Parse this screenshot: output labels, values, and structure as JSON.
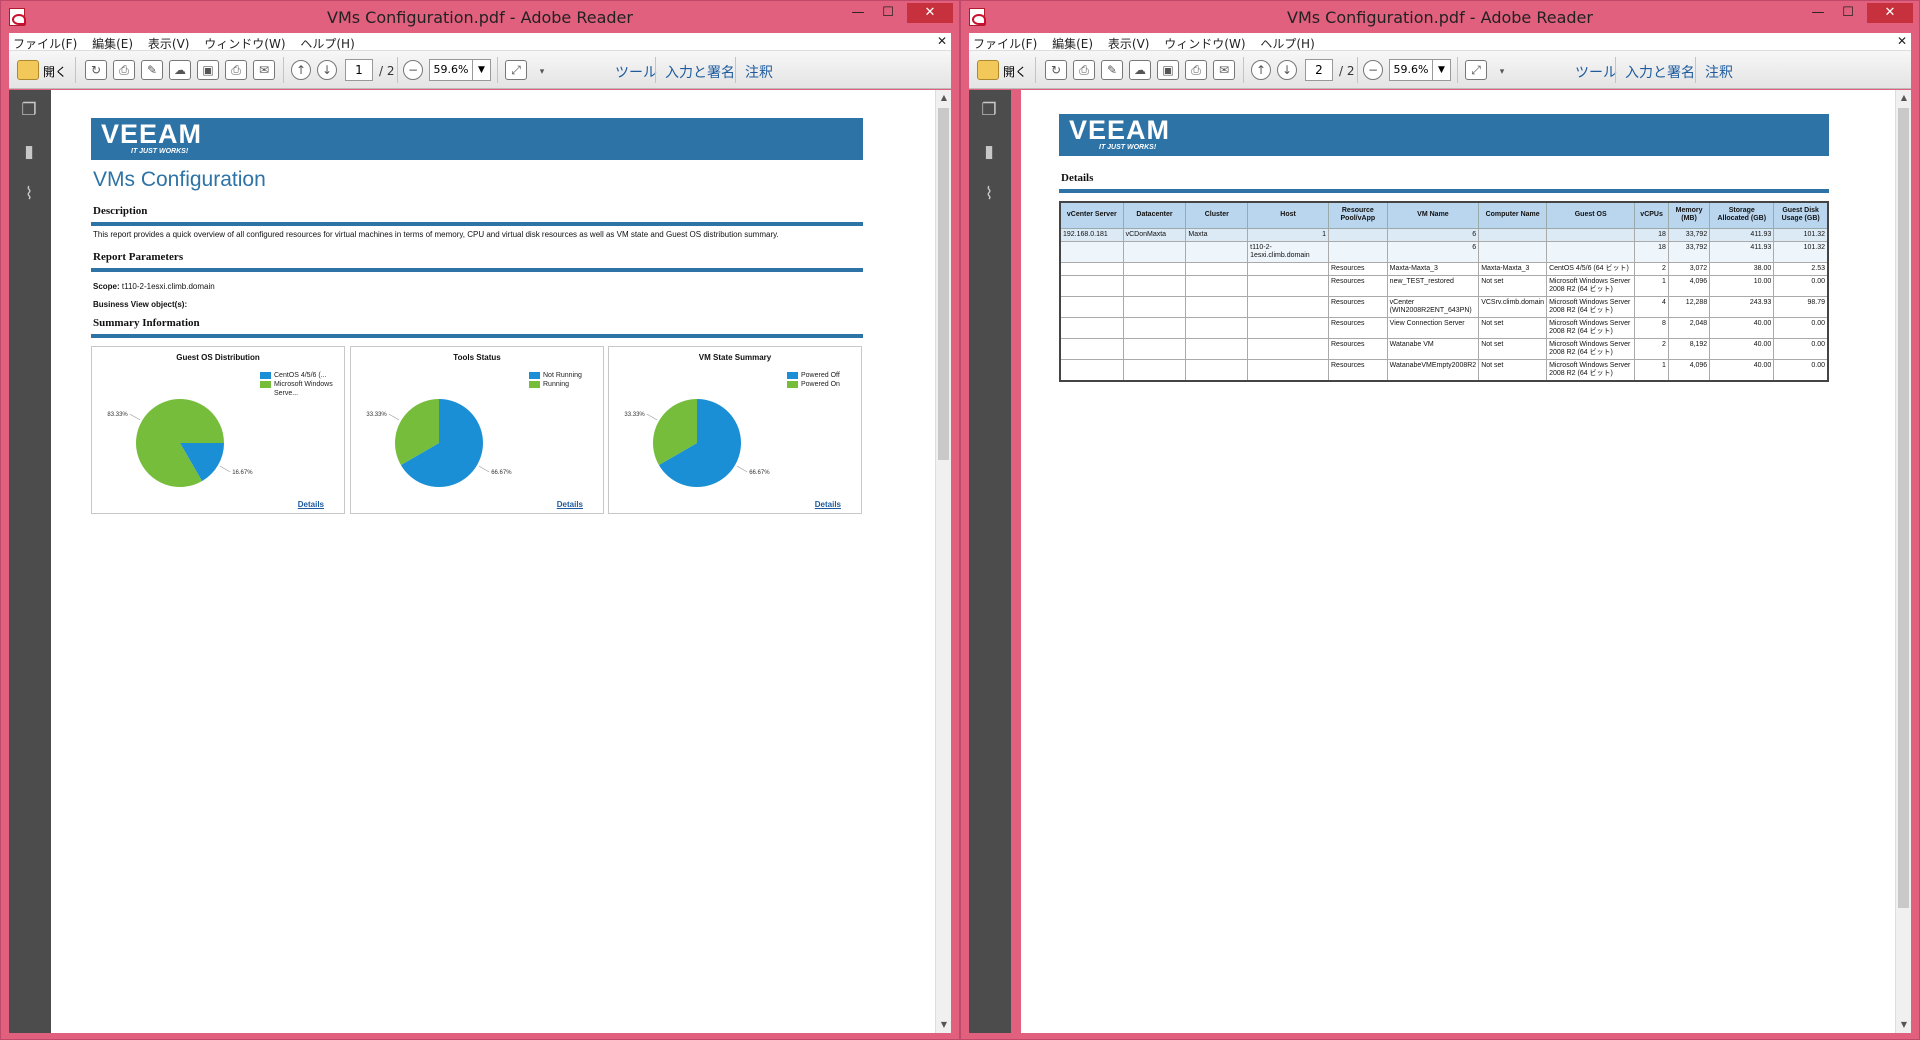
{
  "windows": [
    {
      "title": "VMs Configuration.pdf - Adobe Reader",
      "menu": [
        "ファイル(F)",
        "編集(E)",
        "表示(V)",
        "ウィンドウ(W)",
        "ヘルプ(H)"
      ],
      "toolbar": {
        "open_label": "開く",
        "page_current": "1",
        "page_total": "/ 2",
        "zoom": "59.6%",
        "tools": "ツール",
        "sign": "入力と署名",
        "comment": "注釈"
      },
      "report": {
        "title": "VMs Configuration",
        "description_head": "Description",
        "description": "This report provides a quick overview of all configured resources for virtual machines in terms of memory, CPU and virtual disk resources as well as VM state and Guest OS distribution summary.",
        "params_head": "Report Parameters",
        "scope_label": "Scope:",
        "scope_value": "t110-2-1esxi.climb.domain",
        "bv_label": "Business View object(s):",
        "summary_head": "Summary Information"
      }
    },
    {
      "title": "VMs Configuration.pdf - Adobe Reader",
      "menu": [
        "ファイル(F)",
        "編集(E)",
        "表示(V)",
        "ウィンドウ(W)",
        "ヘルプ(H)"
      ],
      "toolbar": {
        "open_label": "開く",
        "page_current": "2",
        "page_total": "/ 2",
        "zoom": "59.6%",
        "tools": "ツール",
        "sign": "入力と署名",
        "comment": "注釈"
      },
      "details_head": "Details"
    }
  ],
  "logo": {
    "word": "VEEAM",
    "tagline": "IT JUST WORKS!"
  },
  "colors": {
    "blue": "#1a8fd6",
    "green": "#76bd3c",
    "banner": "#2e73a6"
  },
  "chart_data": [
    {
      "type": "pie",
      "title": "Guest OS Distribution",
      "categories": [
        "CentOS 4/5/6 (...",
        "Microsoft Windows Serve..."
      ],
      "values": [
        16.67,
        83.33
      ],
      "labels": [
        "16.67%",
        "83.33%"
      ],
      "legend": "top-right"
    },
    {
      "type": "pie",
      "title": "Tools Status",
      "categories": [
        "Not Running",
        "Running"
      ],
      "values": [
        66.67,
        33.33
      ],
      "labels": [
        "66.67%",
        "33.33%"
      ],
      "legend": "top-right"
    },
    {
      "type": "pie",
      "title": "VM State Summary",
      "categories": [
        "Powered Off",
        "Powered On"
      ],
      "values": [
        66.67,
        33.33
      ],
      "labels": [
        "66.67%",
        "33.33%"
      ],
      "legend": "top-right"
    }
  ],
  "details_link": "Details",
  "table": {
    "headers": [
      "vCenter Server",
      "Datacenter",
      "Cluster",
      "Host",
      "Resource Pool/vApp",
      "VM Name",
      "Computer Name",
      "Guest OS",
      "vCPUs",
      "Memory (MB)",
      "Storage Allocated (GB)",
      "Guest Disk Usage (GB)"
    ],
    "rows": [
      [
        "192.168.0.181",
        "vCDonMaxta",
        "Maxta",
        "1",
        "",
        "6",
        "",
        "",
        "18",
        "33,792",
        "411.93",
        "101.32"
      ],
      [
        "",
        "",
        "",
        "t110-2-1esxi.climb.domain",
        "",
        "6",
        "",
        "",
        "18",
        "33,792",
        "411.93",
        "101.32"
      ],
      [
        "",
        "",
        "",
        "",
        "Resources",
        "Maxta-Maxta_3",
        "Maxta-Maxta_3",
        "CentOS 4/5/6 (64 ビット)",
        "2",
        "3,072",
        "38.00",
        "2.53"
      ],
      [
        "",
        "",
        "",
        "",
        "Resources",
        "new_TEST_restored",
        "Not set",
        "Microsoft Windows Server 2008 R2 (64 ビット)",
        "1",
        "4,096",
        "10.00",
        "0.00"
      ],
      [
        "",
        "",
        "",
        "",
        "Resources",
        "vCenter (WIN2008R2ENT_643PN)",
        "VCSrv.climb.domain",
        "Microsoft Windows Server 2008 R2 (64 ビット)",
        "4",
        "12,288",
        "243.93",
        "98.79"
      ],
      [
        "",
        "",
        "",
        "",
        "Resources",
        "View Connection Server",
        "Not set",
        "Microsoft Windows Server 2008 R2 (64 ビット)",
        "8",
        "2,048",
        "40.00",
        "0.00"
      ],
      [
        "",
        "",
        "",
        "",
        "Resources",
        "Watanabe VM",
        "Not set",
        "Microsoft Windows Server 2008 R2 (64 ビット)",
        "2",
        "8,192",
        "40.00",
        "0.00"
      ],
      [
        "",
        "",
        "",
        "",
        "Resources",
        "WatanabeVMEmpty2008R2",
        "Not set",
        "Microsoft Windows Server 2008 R2 (64 ビット)",
        "1",
        "4,096",
        "40.00",
        "0.00"
      ]
    ]
  }
}
